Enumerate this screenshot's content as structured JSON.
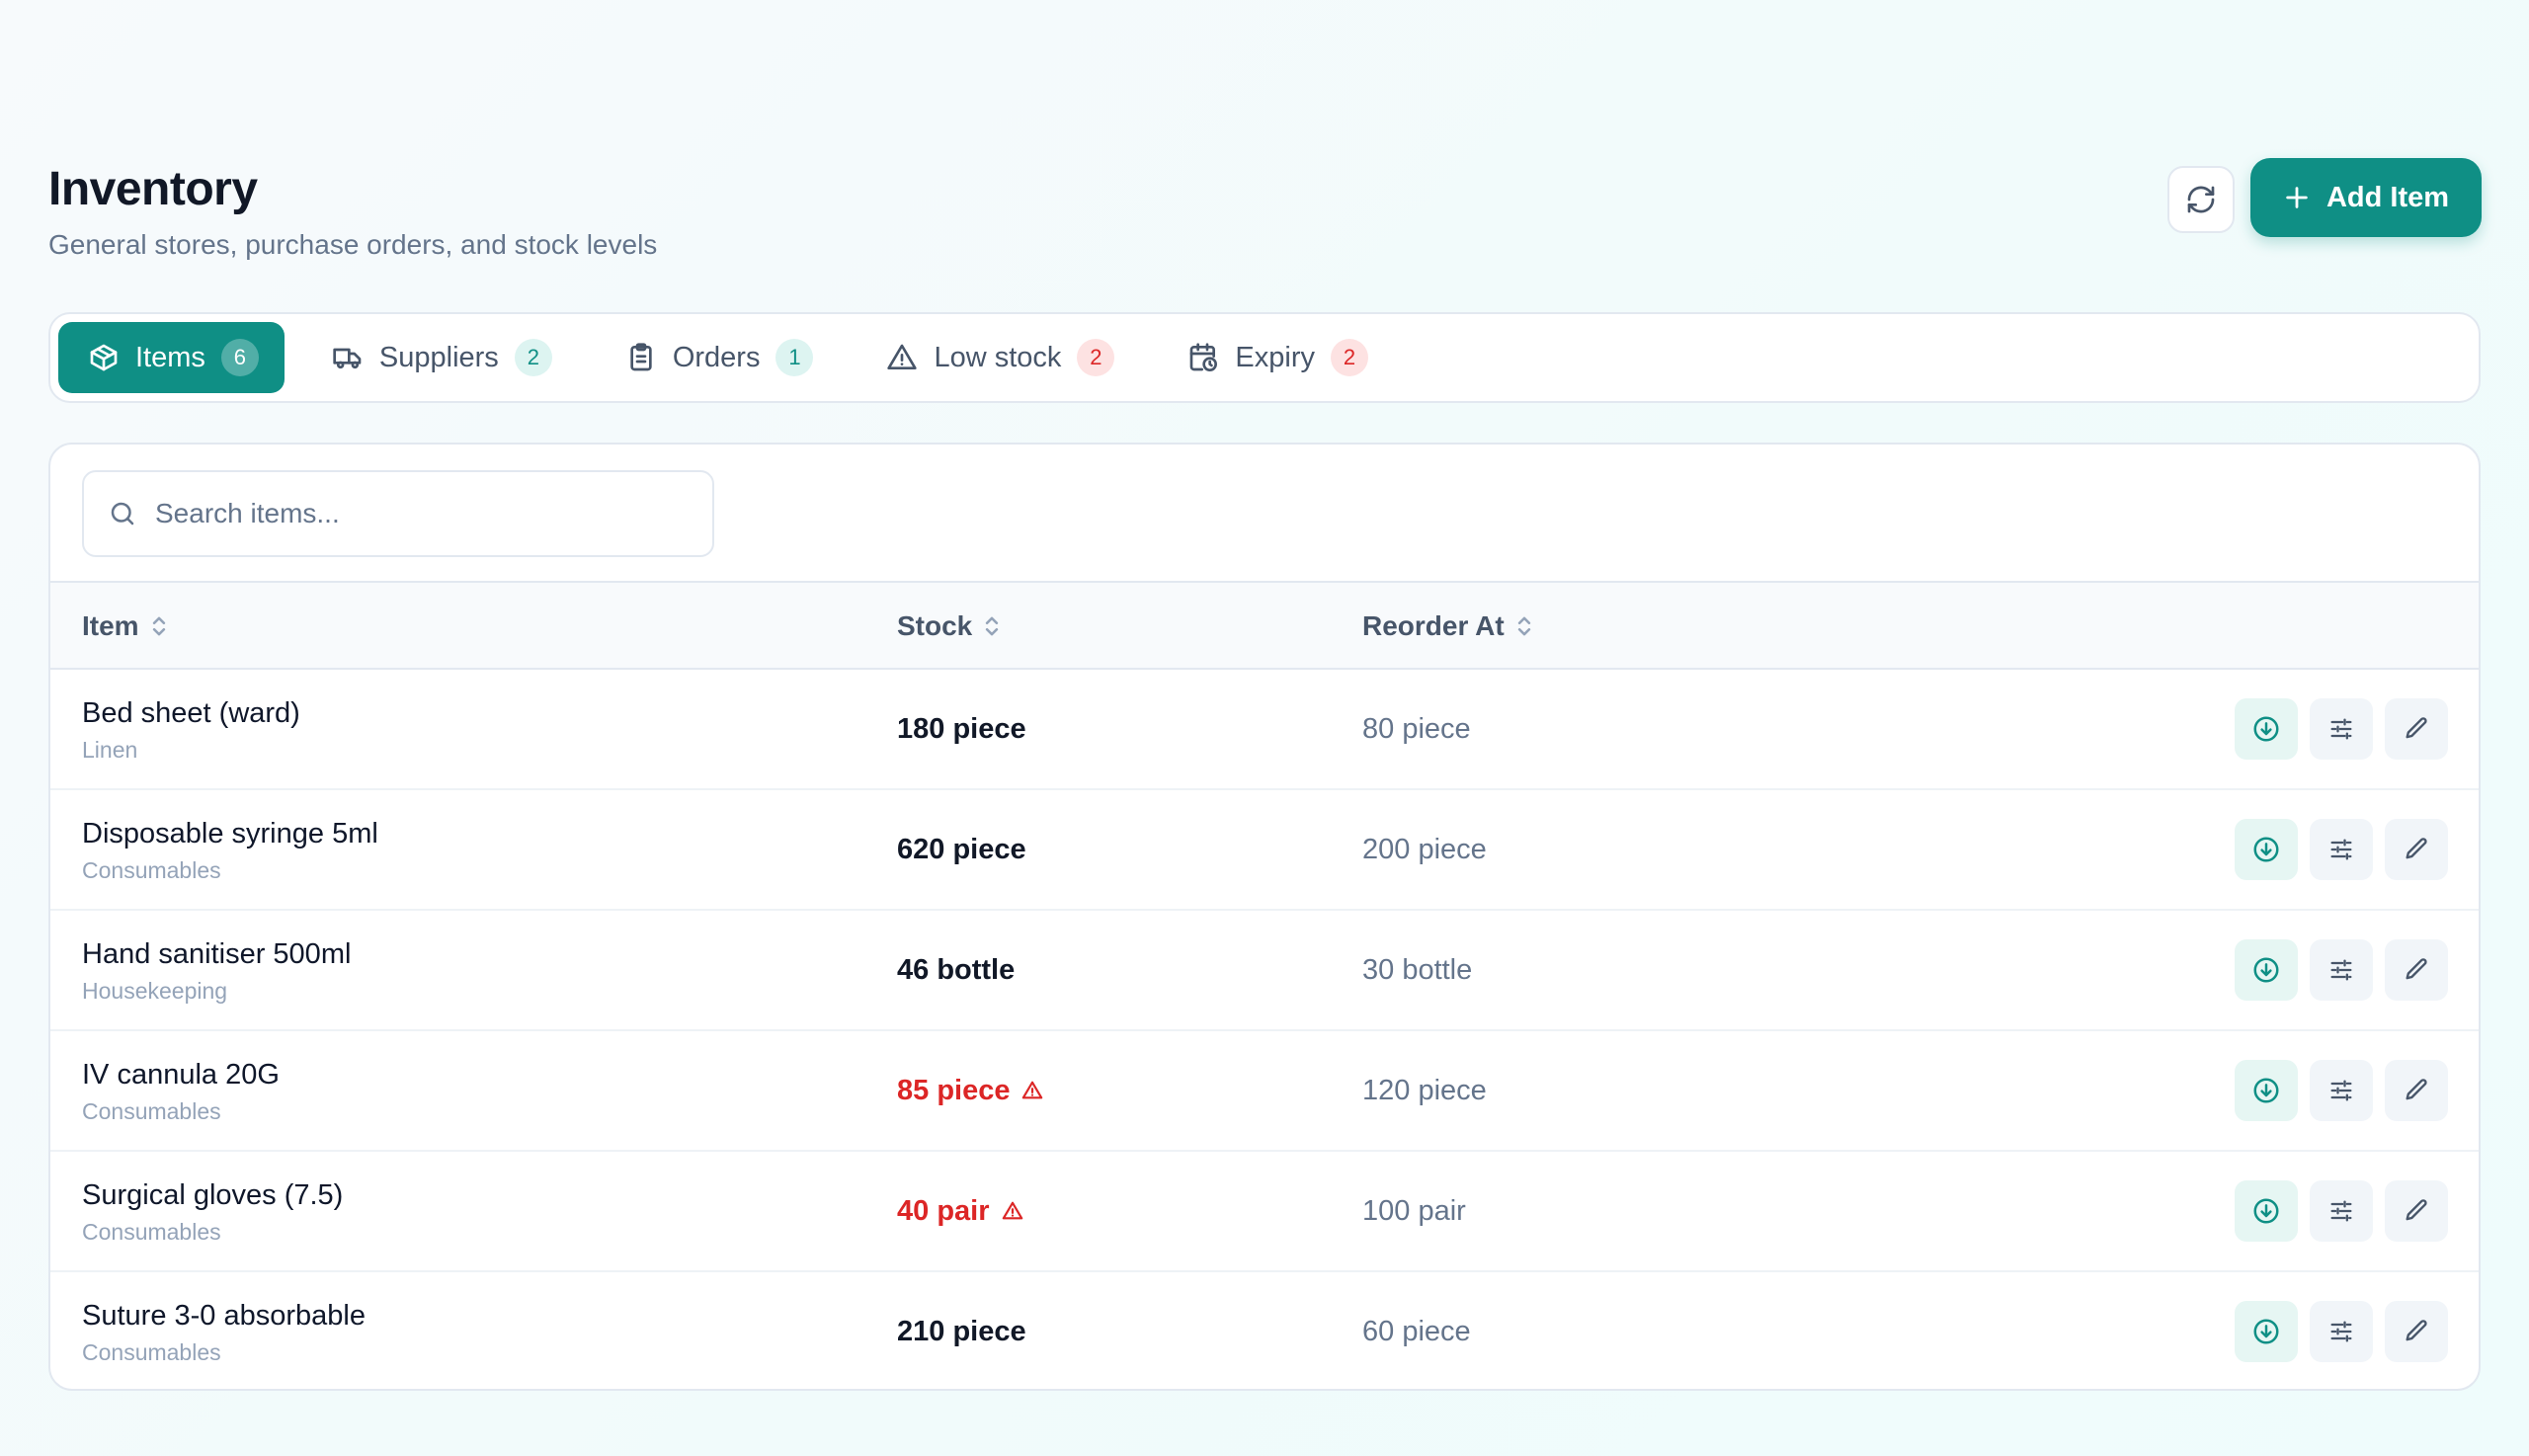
{
  "header": {
    "title": "Inventory",
    "subtitle": "General stores, purchase orders, and stock levels",
    "add_label": "Add Item"
  },
  "tabs": [
    {
      "label": "Items",
      "count": "6"
    },
    {
      "label": "Suppliers",
      "count": "2"
    },
    {
      "label": "Orders",
      "count": "1"
    },
    {
      "label": "Low stock",
      "count": "2"
    },
    {
      "label": "Expiry",
      "count": "2"
    }
  ],
  "search": {
    "placeholder": "Search items...",
    "value": ""
  },
  "table": {
    "columns": [
      "Item",
      "Stock",
      "Reorder At"
    ],
    "rows": [
      {
        "name": "Bed sheet (ward)",
        "category": "Linen",
        "stock": "180 piece",
        "reorder": "80 piece",
        "low": false
      },
      {
        "name": "Disposable syringe 5ml",
        "category": "Consumables",
        "stock": "620 piece",
        "reorder": "200 piece",
        "low": false
      },
      {
        "name": "Hand sanitiser 500ml",
        "category": "Housekeeping",
        "stock": "46 bottle",
        "reorder": "30 bottle",
        "low": false
      },
      {
        "name": "IV cannula 20G",
        "category": "Consumables",
        "stock": "85 piece",
        "reorder": "120 piece",
        "low": true
      },
      {
        "name": "Surgical gloves (7.5)",
        "category": "Consumables",
        "stock": "40 pair",
        "reorder": "100 pair",
        "low": true
      },
      {
        "name": "Suture 3-0 absorbable",
        "category": "Consumables",
        "stock": "210 piece",
        "reorder": "60 piece",
        "low": false
      }
    ]
  },
  "colors": {
    "accent": "#0f8f85",
    "danger": "#dc2626",
    "muted": "#64748b"
  },
  "icons": {
    "refresh": "refresh-icon",
    "add": "plus-icon",
    "tabs": [
      "package-icon",
      "truck-icon",
      "clipboard-icon",
      "alert-triangle-icon",
      "calendar-clock-icon"
    ],
    "search": "search-icon",
    "sort": "sort-icon",
    "row_actions": [
      "receive-stock-icon",
      "adjust-stock-icon",
      "edit-icon"
    ]
  }
}
